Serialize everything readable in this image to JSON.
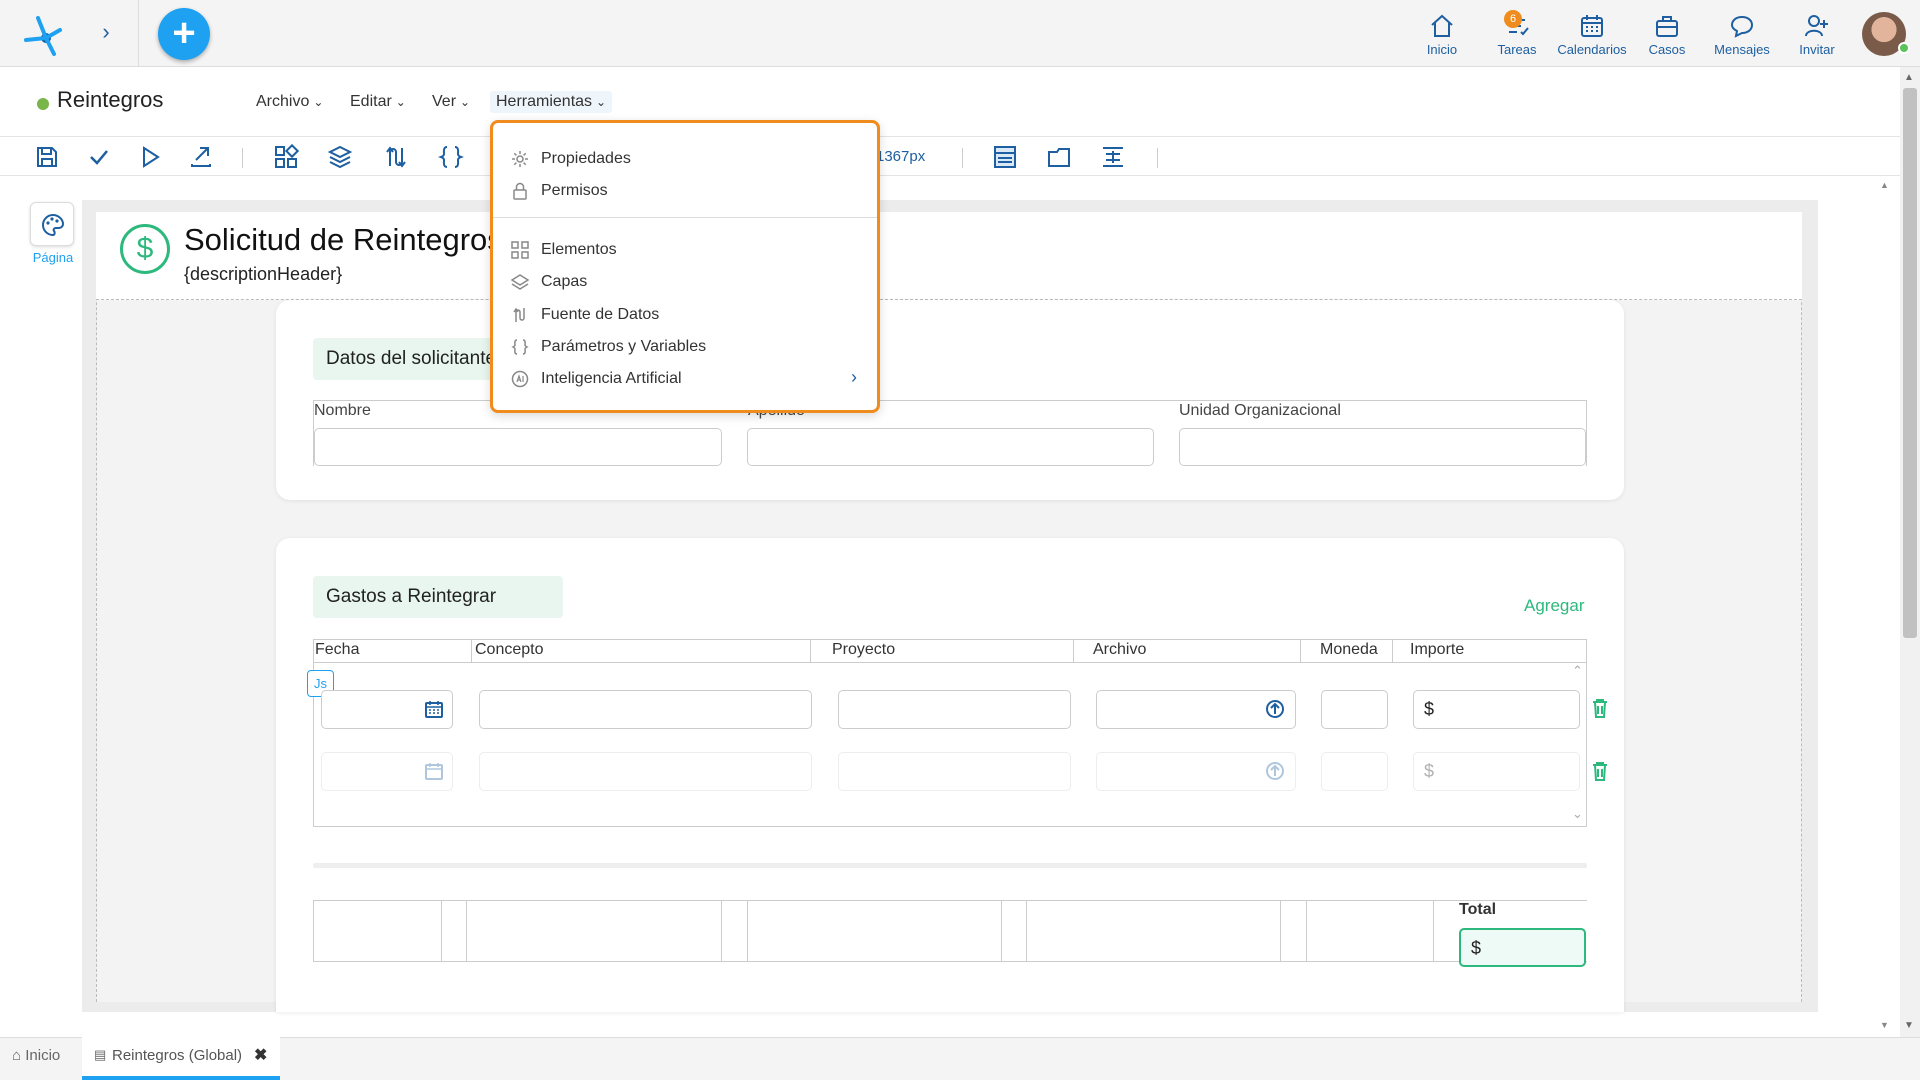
{
  "topnav": {
    "items": [
      {
        "label": "Inicio",
        "icon": "home-icon"
      },
      {
        "label": "Tareas",
        "icon": "tasks-icon",
        "badge": "6"
      },
      {
        "label": "Calendarios",
        "icon": "calendar-icon"
      },
      {
        "label": "Casos",
        "icon": "briefcase-icon"
      },
      {
        "label": "Mensajes",
        "icon": "chat-icon"
      },
      {
        "label": "Invitar",
        "icon": "invite-icon"
      }
    ]
  },
  "titlebar": {
    "title": "Reintegros",
    "status_color": "#79b54a",
    "menus": [
      "Archivo",
      "Editar",
      "Ver",
      "Herramientas"
    ]
  },
  "toolbar": {
    "zoom": "1367px"
  },
  "leftrail": {
    "label": "Página"
  },
  "form": {
    "title": "Solicitud de Reintegros",
    "description": "{descriptionHeader}",
    "section1": {
      "title": "Datos del solicitante",
      "fields": [
        "Nombre",
        "Apellido",
        "Unidad Organizacional"
      ]
    },
    "section2": {
      "title": "Gastos a Reintegrar",
      "add_label": "Agregar",
      "columns": [
        "Fecha",
        "Concepto",
        "Proyecto",
        "Archivo",
        "Moneda",
        "Importe"
      ],
      "currency_symbol": "$",
      "js_badge": "Js"
    },
    "total": {
      "label": "Total",
      "value": "$"
    }
  },
  "dropdown": {
    "group1": [
      {
        "label": "Propiedades",
        "icon": "gear-icon"
      },
      {
        "label": "Permisos",
        "icon": "lock-icon"
      }
    ],
    "group2": [
      {
        "label": "Elementos",
        "icon": "elements-icon"
      },
      {
        "label": "Capas",
        "icon": "layers-icon"
      },
      {
        "label": "Fuente de Datos",
        "icon": "datasource-icon"
      },
      {
        "label": "Parámetros y Variables",
        "icon": "braces-icon"
      },
      {
        "label": "Inteligencia Artificial",
        "icon": "ai-icon"
      }
    ]
  },
  "tabs": [
    {
      "label": "Inicio"
    },
    {
      "label": "Reintegros (Global)"
    }
  ],
  "colors": {
    "accent": "#1ea1f1",
    "green": "#2db87d",
    "orange": "#f08b1e",
    "navy": "#1d5fa0"
  }
}
